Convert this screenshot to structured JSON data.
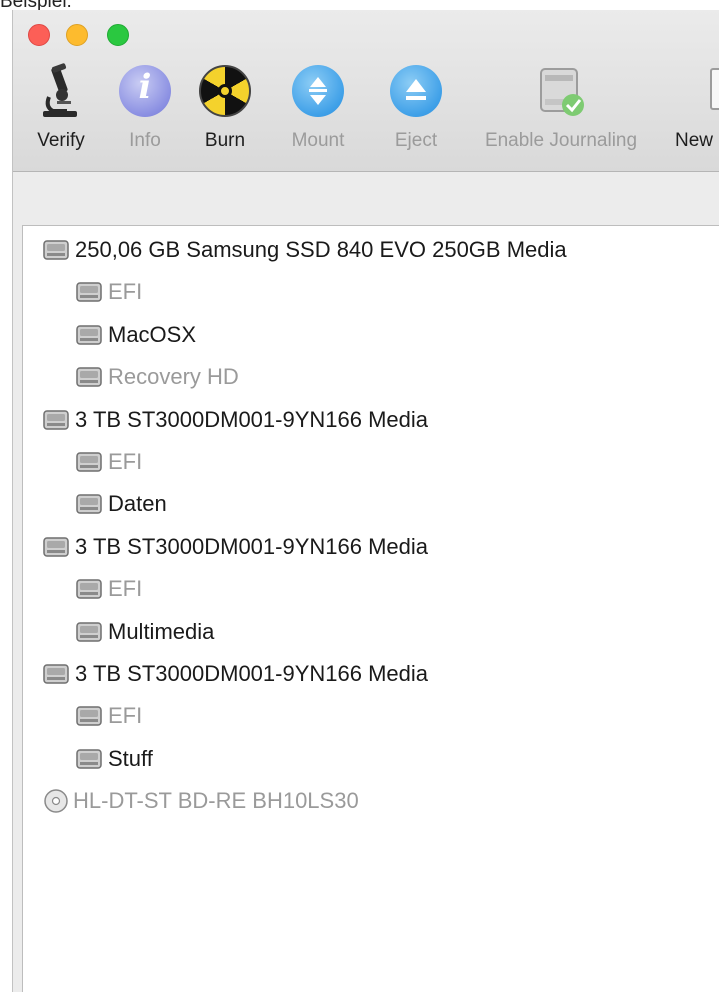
{
  "caption": "Beispiel:",
  "window": {
    "controls": [
      "close",
      "minimize",
      "zoom"
    ]
  },
  "toolbar": {
    "items": [
      {
        "label": "Verify",
        "icon": "microscope-icon",
        "enabled": true
      },
      {
        "label": "Info",
        "icon": "info-icon",
        "enabled": false
      },
      {
        "label": "Burn",
        "icon": "burn-icon",
        "enabled": true
      },
      {
        "label": "Mount",
        "icon": "mount-icon",
        "enabled": false
      },
      {
        "label": "Eject",
        "icon": "eject-icon",
        "enabled": false
      },
      {
        "label": "Enable Journaling",
        "icon": "journaling-icon",
        "enabled": false
      },
      {
        "label": "New",
        "icon": "new-image-icon",
        "enabled": true
      }
    ]
  },
  "disks": [
    {
      "name": "250,06 GB Samsung SSD 840 EVO 250GB Media",
      "level": 0,
      "dim": false,
      "type": "disk"
    },
    {
      "name": "EFI",
      "level": 1,
      "dim": true,
      "type": "disk"
    },
    {
      "name": "MacOSX",
      "level": 1,
      "dim": false,
      "type": "disk"
    },
    {
      "name": "Recovery HD",
      "level": 1,
      "dim": true,
      "type": "disk"
    },
    {
      "name": "3 TB ST3000DM001-9YN166 Media",
      "level": 0,
      "dim": false,
      "type": "disk"
    },
    {
      "name": "EFI",
      "level": 1,
      "dim": true,
      "type": "disk"
    },
    {
      "name": "Daten",
      "level": 1,
      "dim": false,
      "type": "disk"
    },
    {
      "name": "3 TB ST3000DM001-9YN166 Media",
      "level": 0,
      "dim": false,
      "type": "disk"
    },
    {
      "name": "EFI",
      "level": 1,
      "dim": true,
      "type": "disk"
    },
    {
      "name": "Multimedia",
      "level": 1,
      "dim": false,
      "type": "disk"
    },
    {
      "name": "3 TB ST3000DM001-9YN166 Media",
      "level": 0,
      "dim": false,
      "type": "disk"
    },
    {
      "name": "EFI",
      "level": 1,
      "dim": true,
      "type": "disk"
    },
    {
      "name": "Stuff",
      "level": 1,
      "dim": false,
      "type": "disk"
    },
    {
      "name": "HL-DT-ST BD-RE BH10LS30",
      "level": 0,
      "dim": true,
      "type": "optical"
    }
  ],
  "colors": {
    "close": "#fc5f57",
    "minimize": "#fdbb2e",
    "zoom": "#2ac840",
    "disabled_text": "#9a9a9a"
  }
}
